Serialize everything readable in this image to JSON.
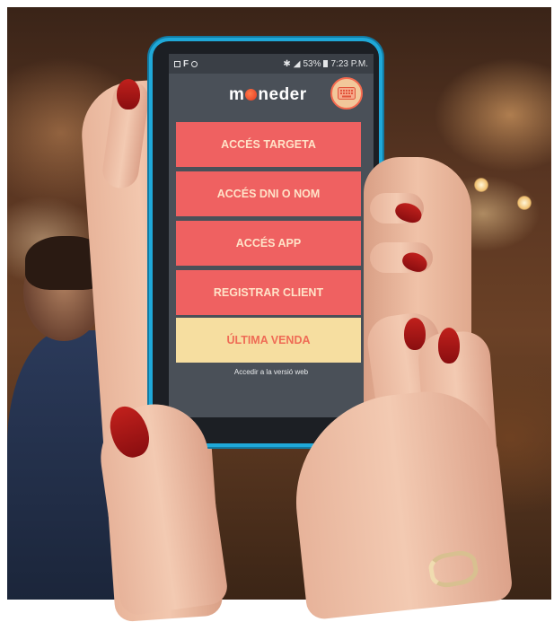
{
  "status_bar": {
    "battery": "53%",
    "time": "7:23 P.M."
  },
  "app": {
    "logo_part1": "m",
    "logo_part2": "neder"
  },
  "menu": {
    "card_access": "ACCÉS TARGETA",
    "dni_access": "ACCÉS DNI O NOM",
    "app_access": "ACCÉS APP",
    "register_client": "REGISTRAR CLIENT",
    "last_sale": "ÚLTIMA VENDA"
  },
  "footer": {
    "web_link": "Accedir a la versió web"
  },
  "icons": {
    "keyboard": "keyboard-icon",
    "logo_dot": "coin-dot-icon"
  },
  "colors": {
    "primary_button": "#ef6161",
    "secondary_button": "#f6dea0",
    "screen_bg": "#4a5058",
    "phone_frame": "#1fa8d8"
  }
}
